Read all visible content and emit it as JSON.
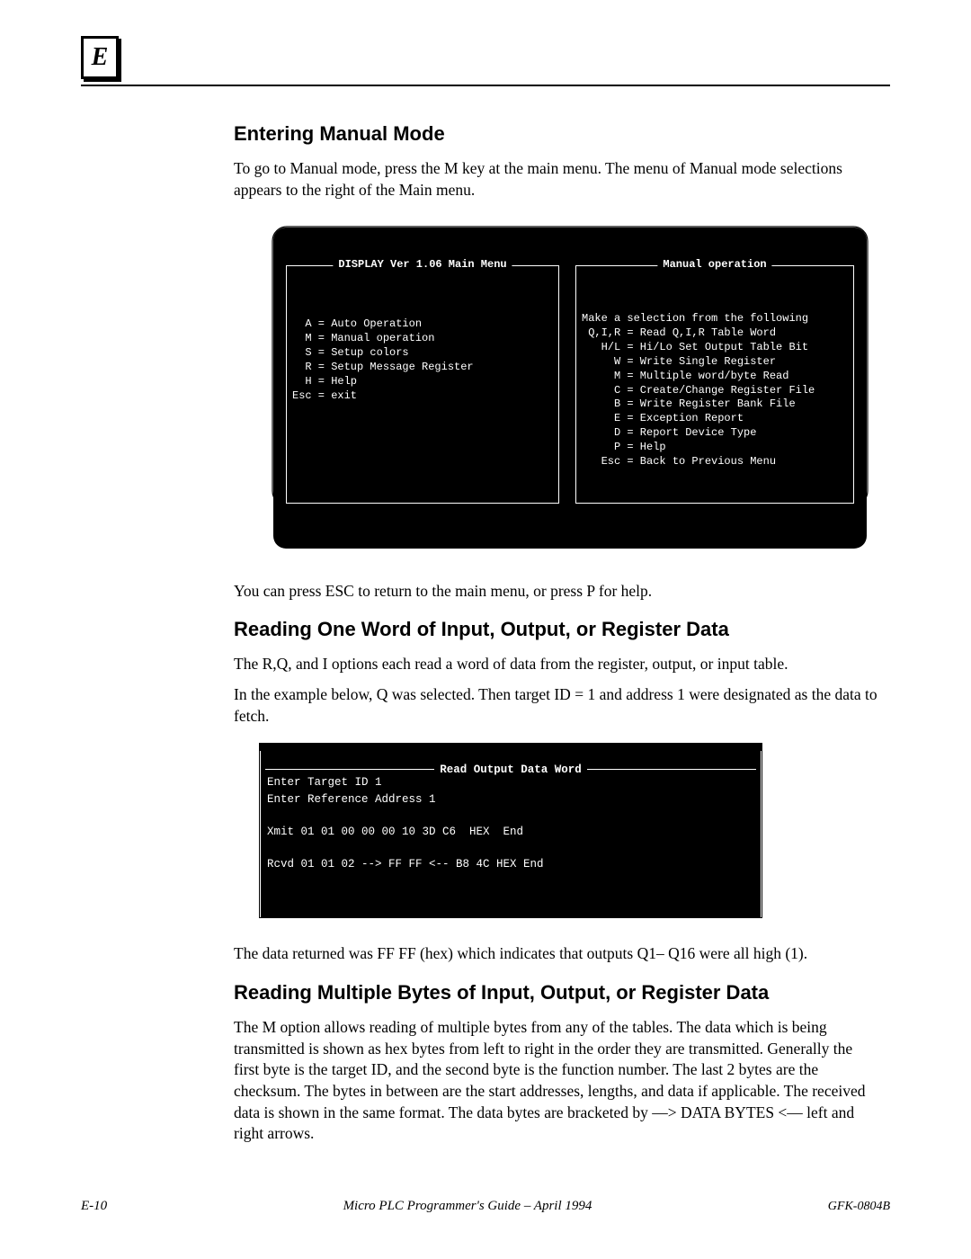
{
  "appendix_letter": "E",
  "sections": {
    "s1": {
      "title": "Entering Manual Mode",
      "p1": "To go to Manual mode, press the M key at the main menu.  The menu of Manual mode selections appears to the right of the Main menu.",
      "p2": "You can press ESC to return to the main menu, or press P for help."
    },
    "s2": {
      "title": "Reading One Word of Input, Output, or Register Data",
      "p1": "The R,Q, and I options each read a word of data from the register, output, or input table.",
      "p2": "In the example below, Q was selected.  Then target ID = 1 and address 1 were designated as the data to fetch.",
      "p3": "The data returned was FF FF (hex) which indicates that outputs Q1– Q16 were all high (1)."
    },
    "s3": {
      "title": "Reading Multiple Bytes of Input, Output, or Register Data",
      "p1": "The M option allows reading of multiple bytes from any of the tables.  The data which is being transmitted is shown as hex bytes from left to right in the order they are transmitted.  Generally the first byte is the target ID, and the second byte is the function number. The last 2 bytes are the checksum.  The bytes in between are the start addresses, lengths, and data if applicable.  The received data is shown in the same format.  The data bytes are bracketed  by  —>  DATA BYTES <—  left and  right arrows."
    }
  },
  "term1": {
    "left_title": "DISPLAY Ver 1.06 Main Menu",
    "left_lines": "  A = Auto Operation\n  M = Manual operation\n  S = Setup colors\n  R = Setup Message Register\n  H = Help\nEsc = exit",
    "right_title": "Manual operation",
    "right_lines": "Make a selection from the following\n Q,I,R = Read Q,I,R Table Word\n   H/L = Hi/Lo Set Output Table Bit\n     W = Write Single Register\n     M = Multiple word/byte Read\n     C = Create/Change Register File\n     B = Write Register Bank File\n     E = Exception Report\n     D = Report Device Type\n     P = Help\n   Esc = Back to Previous Menu"
  },
  "term2": {
    "title": "Read Output Data Word",
    "body": "Enter Target ID 1\nEnter Reference Address 1\n\nXmit 01 01 00 00 00 10 3D C6  HEX  End\n\nRcvd 01 01 02 --> FF FF <-- B8 4C HEX End"
  },
  "footer": {
    "page": "E-10",
    "guide": "Micro PLC Programmer's Guide – April 1994",
    "docnum": "GFK-0804B"
  }
}
